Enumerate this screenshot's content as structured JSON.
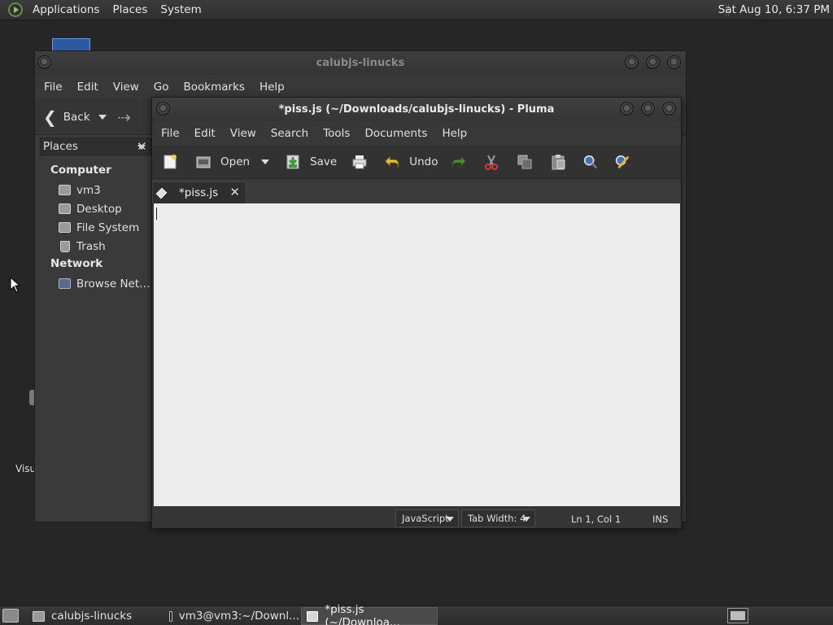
{
  "top_panel": {
    "menu": [
      "Applications",
      "Places",
      "System"
    ],
    "clock": "Sat Aug 10,  6:37 PM"
  },
  "desktop": {
    "partial_label": "Visu"
  },
  "file_manager": {
    "title": "calubjs-linucks",
    "menu": [
      "File",
      "Edit",
      "View",
      "Go",
      "Bookmarks",
      "Help"
    ],
    "toolbar": {
      "back_label": "Back"
    },
    "sidebar": {
      "header": "Places",
      "close": "✕",
      "sections": [
        {
          "heading": "Computer",
          "items": [
            "vm3",
            "Desktop",
            "File System",
            "Trash"
          ]
        },
        {
          "heading": "Network",
          "items": [
            "Browse Net…"
          ]
        }
      ]
    }
  },
  "pluma": {
    "title": "*piss.js (~/Downloads/calubjs-linucks) - Pluma",
    "menu": [
      "File",
      "Edit",
      "View",
      "Search",
      "Tools",
      "Documents",
      "Help"
    ],
    "toolbar": {
      "open_label": "Open",
      "save_label": "Save",
      "undo_label": "Undo"
    },
    "tab": {
      "label": "*piss.js",
      "close": "✕"
    },
    "editor_content": "",
    "status": {
      "language": "JavaScript",
      "tab_width": "Tab Width:  4",
      "position": "Ln 1, Col 1",
      "mode": "INS"
    }
  },
  "taskbar": {
    "tasks": [
      {
        "label": "calubjs-linucks",
        "active": false
      },
      {
        "label": "vm3@vm3:~/Downl...",
        "active": false
      },
      {
        "label": "*piss.js (~/Downloa...",
        "active": true
      }
    ]
  }
}
